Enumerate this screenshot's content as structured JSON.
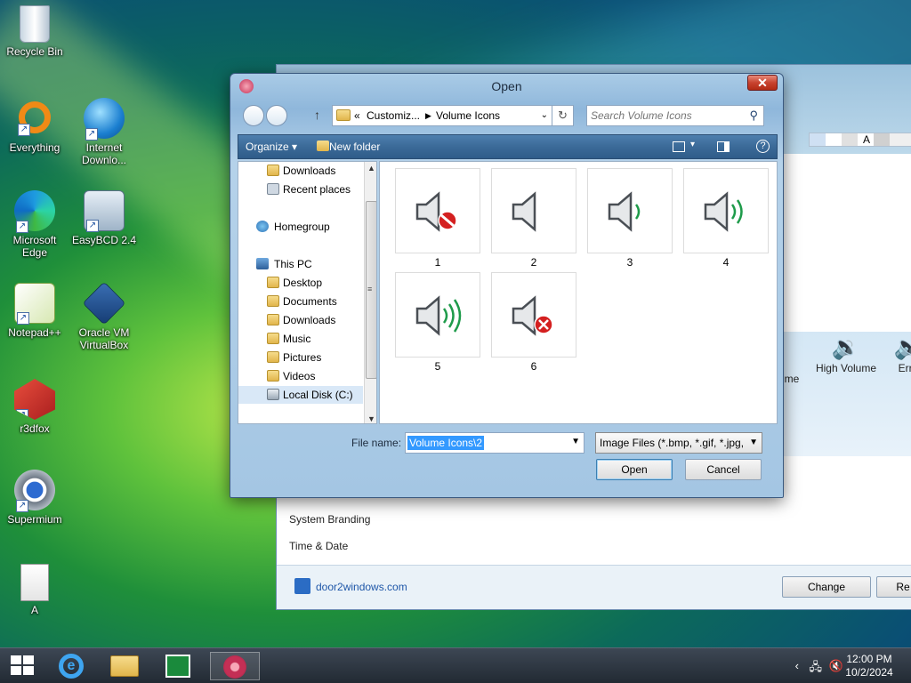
{
  "desktop": {
    "icons": [
      {
        "label": "Recycle Bin"
      },
      {
        "label": "Everything"
      },
      {
        "label": "Internet Downlo..."
      },
      {
        "label": "Microsoft Edge"
      },
      {
        "label": "EasyBCD 2.4"
      },
      {
        "label": "Notepad++"
      },
      {
        "label": "Oracle VM VirtualBox"
      },
      {
        "label": "r3dfox"
      },
      {
        "label": "Supermium"
      },
      {
        "label": "A"
      }
    ]
  },
  "bg_window": {
    "list_items": [
      "System Branding",
      "Time & Date"
    ],
    "volume_items": [
      "ume",
      "High Volume",
      "Erro"
    ],
    "strip_letter": "A",
    "brand_link": "door2windows.com",
    "change_button": "Change",
    "reset_button": "Re"
  },
  "dialog": {
    "title": "Open",
    "close_glyph": "✕",
    "address": {
      "chevron": "«",
      "crumb1": "Customiz...",
      "sep": "▶",
      "crumb2": "Volume Icons"
    },
    "search_placeholder": "Search Volume Icons",
    "toolbar": {
      "organize": "Organize ▾",
      "new_folder": "New folder",
      "help": "?"
    },
    "nav_tree": [
      {
        "label": "Downloads"
      },
      {
        "label": "Recent places"
      },
      {
        "label": "Homegroup"
      },
      {
        "label": "This PC"
      },
      {
        "label": "Desktop"
      },
      {
        "label": "Documents"
      },
      {
        "label": "Downloads"
      },
      {
        "label": "Music"
      },
      {
        "label": "Pictures"
      },
      {
        "label": "Videos"
      },
      {
        "label": "Local Disk (C:)"
      }
    ],
    "files": [
      {
        "label": "1",
        "icon": "speaker-muted-icon"
      },
      {
        "label": "2",
        "icon": "speaker-silent-icon"
      },
      {
        "label": "3",
        "icon": "speaker-low-icon"
      },
      {
        "label": "4",
        "icon": "speaker-medium-icon"
      },
      {
        "label": "5",
        "icon": "speaker-high-icon"
      },
      {
        "label": "6",
        "icon": "speaker-error-icon"
      }
    ],
    "file_name_label": "File name:",
    "file_name_value": "Volume Icons\\2",
    "file_type": "Image Files (*.bmp, *.gif, *.jpg,",
    "open_button": "Open",
    "cancel_button": "Cancel"
  },
  "taskbar": {
    "time": "12:00 PM",
    "date": "10/2/2024",
    "tray_chevron": "‹"
  },
  "colors": {
    "accent": "#3399ff",
    "error_red": "#d42020",
    "volume_green": "#1e9b4a"
  }
}
